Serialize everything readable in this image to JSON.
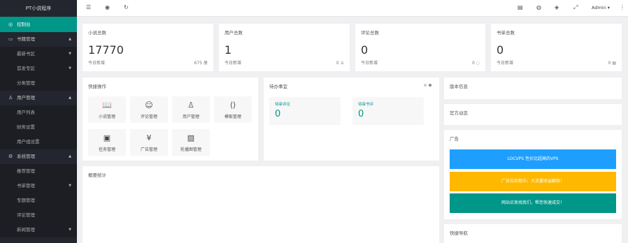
{
  "app": {
    "title": "PT小说程序"
  },
  "sidebar": {
    "items": [
      {
        "label": "控制台",
        "icon": "dashboard-icon"
      },
      {
        "label": "书籍管理",
        "icon": "book-icon"
      },
      {
        "label": "最新书区"
      },
      {
        "label": "首发专区"
      },
      {
        "label": "分类管理"
      },
      {
        "label": "用户管理",
        "icon": "user-icon"
      },
      {
        "label": "用户列表"
      },
      {
        "label": "财务设置"
      },
      {
        "label": "用户组设置"
      },
      {
        "label": "系统管理",
        "icon": "settings-icon"
      },
      {
        "label": "推荐管理"
      },
      {
        "label": "书单管理"
      },
      {
        "label": "专题管理"
      },
      {
        "label": "评论管理"
      },
      {
        "label": "新闻管理"
      }
    ]
  },
  "topbar": {
    "user": "Admin"
  },
  "stats": [
    {
      "title": "小说总数",
      "value": "17770",
      "foot": "今日新增",
      "right": "675 册"
    },
    {
      "title": "用户总数",
      "value": "1",
      "foot": "今日新增",
      "right": "0"
    },
    {
      "title": "评论总数",
      "value": "0",
      "foot": "今日新增",
      "right": "0"
    },
    {
      "title": "书单总数",
      "value": "0",
      "foot": "今日新增",
      "right": "0"
    }
  ],
  "quick": {
    "title": "快捷操作",
    "tiles": [
      {
        "label": "小说管理",
        "icon": "book-icon"
      },
      {
        "label": "评论管理",
        "icon": "comment-icon"
      },
      {
        "label": "用户管理",
        "icon": "user-icon"
      },
      {
        "label": "模板管理",
        "icon": "template-icon"
      },
      {
        "label": "任务管理",
        "icon": "task-icon"
      },
      {
        "label": "广告管理",
        "icon": "yen-icon"
      },
      {
        "label": "轮播图管理",
        "icon": "image-icon"
      }
    ]
  },
  "todo": {
    "title": "待办事宜",
    "boxes": [
      {
        "label": "待审评论",
        "value": "0"
      },
      {
        "label": "待审书评",
        "value": "0"
      }
    ]
  },
  "version": {
    "title": "版本信息"
  },
  "official": {
    "title": "官方动态"
  },
  "ads": {
    "title": "广告",
    "items": [
      {
        "text": "LOCVPS 性价比超高的VPS",
        "color": "#1E9FFF"
      },
      {
        "text": "广告位招租中，大流量收益翻倍！",
        "color": "#FFB800"
      },
      {
        "text": "网站买卖找我们，帮您快速成交！",
        "color": "#009688"
      }
    ]
  },
  "traffic": {
    "title": "概要统计"
  },
  "quicknav": {
    "title": "快捷导航"
  }
}
